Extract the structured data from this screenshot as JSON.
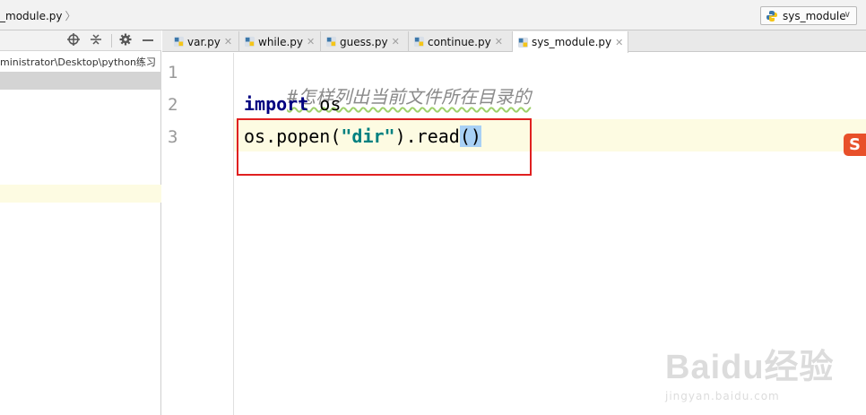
{
  "navbar": {
    "breadcrumb": "_module.py",
    "run_config": "sys_module"
  },
  "project": {
    "path": "ministrator\\Desktop\\python练习"
  },
  "tabs": [
    {
      "label": "var.py"
    },
    {
      "label": "while.py"
    },
    {
      "label": "guess.py"
    },
    {
      "label": "continue.py"
    },
    {
      "label": "sys_module.py",
      "active": true
    }
  ],
  "editor": {
    "line_numbers": [
      "1",
      "2",
      "3"
    ],
    "line1": {
      "comment": "#怎样列出当前文件所在目录的"
    },
    "line2": {
      "keyword": "import",
      "rest": " os"
    },
    "line3": {
      "prefix": "os.popen(",
      "string": "\"dir\"",
      "middle": ").read",
      "paren": "()"
    }
  },
  "badges": {
    "sogou": "S"
  },
  "watermark": {
    "main": "Baidu经验",
    "sub": "jingyan.baidu.com"
  },
  "colors": {
    "keyword": "#000080",
    "string": "#008080",
    "comment": "#8a8a8a",
    "caret_line": "#fdfbe2",
    "highlight_box": "#e02020"
  },
  "icons": [
    "python-file-icon",
    "target-icon",
    "collapse-icon",
    "gear-icon",
    "minimize-icon",
    "close-icon",
    "chevron-down-icon"
  ]
}
